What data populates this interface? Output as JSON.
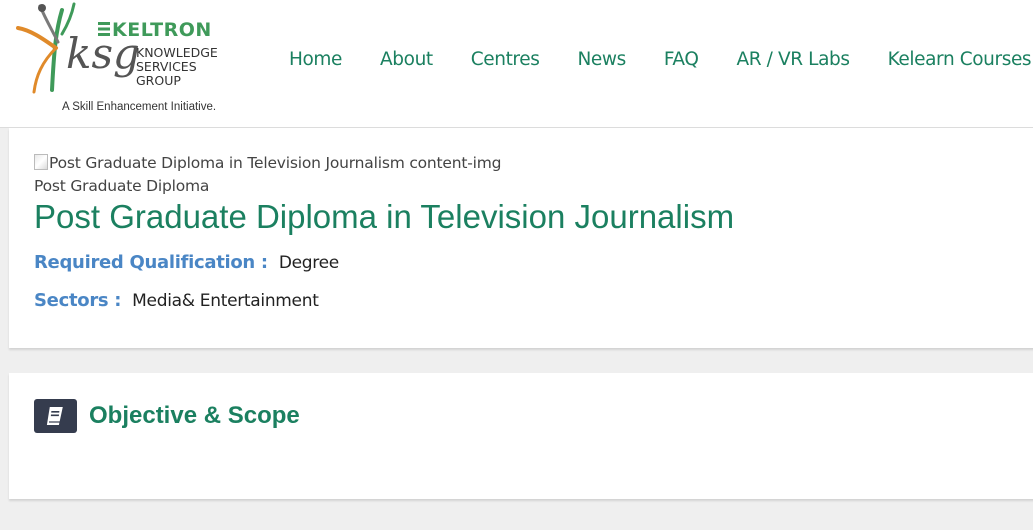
{
  "logo": {
    "brand": "KELTRON",
    "letters": "ksg",
    "group_name": "KNOWLEDGE\nSERVICES\nGROUP",
    "tagline": "A Skill Enhancement Initiative.",
    "colors": {
      "green": "#3f9a5a",
      "orange": "#e08a2a",
      "dark": "#555555"
    }
  },
  "nav": {
    "items": [
      "Home",
      "About",
      "Centres",
      "News",
      "FAQ",
      "AR / VR Labs",
      "Kelearn Courses"
    ],
    "color": "#1b8060"
  },
  "course": {
    "image_alt": "Post Graduate Diploma in Television Journalism content-img",
    "type": "Post Graduate Diploma",
    "title": "Post Graduate Diploma in Television Journalism",
    "qualification_label": "Required Qualification :",
    "qualification_value": "Degree",
    "sectors_label": "Sectors :",
    "sectors_value": "Media& Entertainment"
  },
  "objective": {
    "icon": "book-icon",
    "title": "Objective & Scope"
  },
  "colors": {
    "title_green": "#1b8060",
    "label_blue": "#4a86c5",
    "icon_bg": "#353c4e",
    "page_bg": "#efefef"
  }
}
